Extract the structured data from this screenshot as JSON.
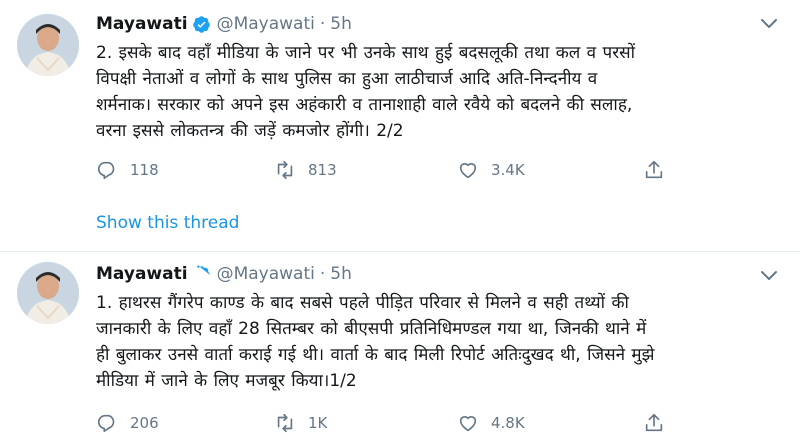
{
  "colors": {
    "accent": "#1b95e0",
    "muted": "#657786",
    "text": "#14171a",
    "divider": "#e6ecf0"
  },
  "tweets": [
    {
      "name": "Mayawati",
      "handle": "@Mayawati",
      "separator": "·",
      "time": "5h",
      "text_lines": [
        "2. इसके बाद वहाँ मीडिया के जाने पर भी उनके साथ हुई बदसलूकी तथा कल व परसों",
        "विपक्षी नेताओं व लोगों के साथ पुलिस का हुआ लाठीचार्ज आदि अति-निन्दनीय व",
        "शर्मनाक। सरकार को अपने इस अहंकारी व तानाशाही वाले रवैये को बदलने की सलाह,",
        "वरना इससे लोकतन्त्र की जड़ें कमजोर होंगी। 2/2"
      ],
      "replies": "118",
      "retweets": "813",
      "likes": "3.4K",
      "show_thread": "Show this thread"
    },
    {
      "name": "Mayawati",
      "handle": "@Mayawati",
      "separator": "·",
      "time": "5h",
      "text_lines": [
        "1. हाथरस गैंगरेप काण्ड के बाद सबसे पहले पीड़ित परिवार से मिलने व सही तथ्यों की",
        "जानकारी के लिए वहाँ 28 सितम्बर को बीएसपी प्रतिनिधिमण्डल गया था, जिनकी थाने में",
        "ही बुलाकर उनसे वार्ता कराई गई थी। वार्ता के बाद मिली रिपोर्ट अतिःदुखद थी, जिसने मुझे",
        "मीडिया में जाने के लिए मजबूर किया।1/2"
      ],
      "replies": "206",
      "retweets": "1K",
      "likes": "4.8K"
    }
  ],
  "icons": [
    "verified-badge-icon",
    "chevron-down-icon",
    "reply-icon",
    "retweet-icon",
    "like-icon",
    "share-icon"
  ]
}
